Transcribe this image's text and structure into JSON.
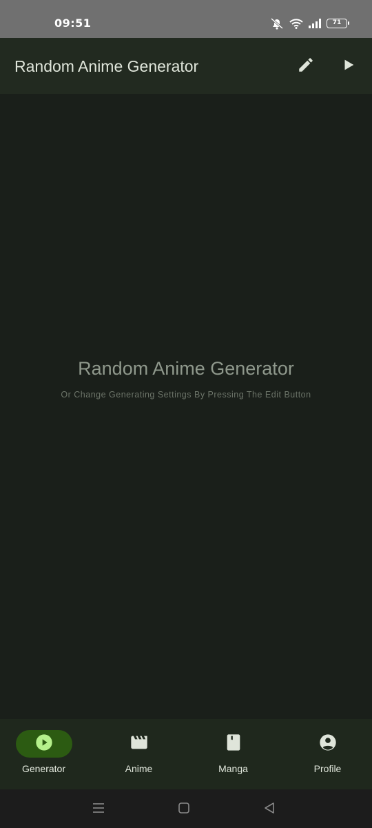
{
  "status_bar": {
    "time": "09:51",
    "battery_level": "71",
    "icons": [
      "mute-vibrate-icon",
      "wifi-icon",
      "signal-icon",
      "battery-icon"
    ]
  },
  "app_bar": {
    "title": "Random Anime Generator",
    "actions": [
      "edit-icon",
      "play-icon"
    ]
  },
  "main": {
    "empty_title": "Random Anime Generator",
    "empty_subtitle": "Or Change Generating Settings By Pressing The Edit Button"
  },
  "bottom_nav": {
    "items": [
      {
        "label": "Generator",
        "icon": "play-circle-icon",
        "active": true
      },
      {
        "label": "Anime",
        "icon": "movie-icon",
        "active": false
      },
      {
        "label": "Manga",
        "icon": "book-icon",
        "active": false
      },
      {
        "label": "Profile",
        "icon": "account-circle-icon",
        "active": false
      }
    ]
  },
  "system_nav": [
    "recents-button",
    "home-button",
    "back-button"
  ],
  "colors": {
    "background": "#1a1f1a",
    "app_bar": "#222a20",
    "nav_bar": "#1f281d",
    "active_indicator": "#2c5b12",
    "active_icon": "#b5f08b",
    "text": "#dfe5da"
  }
}
